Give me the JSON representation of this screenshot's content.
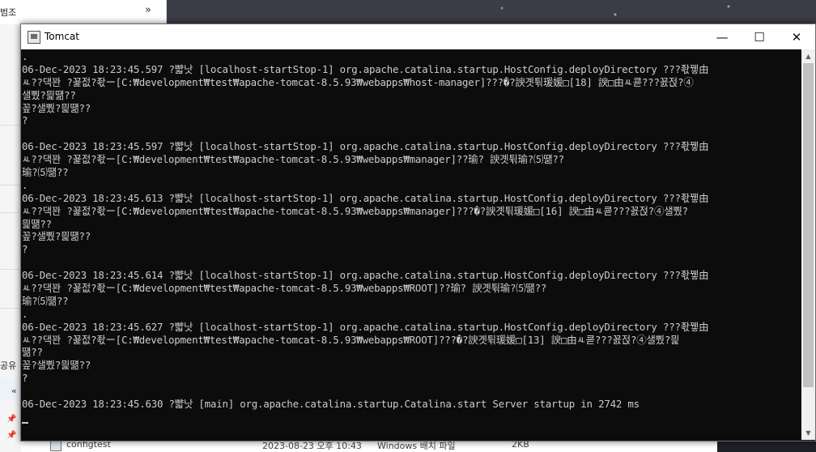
{
  "explorer": {
    "crumb": "범조",
    "chevron": "»",
    "share": "공유",
    "left_arrow": "«",
    "bottom_file": {
      "name": "configtest",
      "date": "2023-08-23 오후 10:43",
      "type": "Windows 배치 파일",
      "size": "2KB"
    }
  },
  "window": {
    "title": "Tomcat",
    "minimize": "—",
    "maximize": "☐",
    "close": "✕"
  },
  "console": {
    "lines": [
      ".",
      "06-Dec-2023 18:23:45.597 ?뺣낫 [localhost-startStop-1] org.apache.catalina.startup.HostConfig.deployDirectory ???좏뀋由",
      "ㅻ??댁꽌 ?꾩젒?좏ー[C:₩development₩test₩apache-tomcat-8.5.93₩webapps₩host-manager]???�?諛곗튂瑗媛□[18] 諛□由ㅻ쿋???꾨젅?④",
      "샐뿼?믩떎??",
      "꽆?샐뿼?믩떎??",
      "?",
      "",
      "06-Dec-2023 18:23:45.597 ?뺣낫 [localhost-startStop-1] org.apache.catalina.startup.HostConfig.deployDirectory ???좏뀋由",
      "ㅻ??댁꽌 ?꾩젒?좏ー[C:₩development₩test₩apache-tomcat-8.5.93₩webapps₩manager]??瑜? 諛곗튂瑜?⑸떎??",
      "瑜?⑸떎??",
      ".",
      "06-Dec-2023 18:23:45.613 ?뺣낫 [localhost-startStop-1] org.apache.catalina.startup.HostConfig.deployDirectory ???좏뀋由",
      "ㅻ??댁꽌 ?꾩젒?좏ー[C:₩development₩test₩apache-tomcat-8.5.93₩webapps₩manager]???�?諛곗튂瑗媛□[16] 諛□由ㅻ쿋???꾨젅?④샐뿼?",
      "믩떎??",
      "꽆?샐뿼?믩떎??",
      "?",
      "",
      "06-Dec-2023 18:23:45.614 ?뺣낫 [localhost-startStop-1] org.apache.catalina.startup.HostConfig.deployDirectory ???좏뀋由",
      "ㅻ??댁꽌 ?꾩젒?좏ー[C:₩development₩test₩apache-tomcat-8.5.93₩webapps₩ROOT]??瑜? 諛곗튂瑜?⑸떎??",
      "瑜?⑸떎??",
      ".",
      "06-Dec-2023 18:23:45.627 ?뺣낫 [localhost-startStop-1] org.apache.catalina.startup.HostConfig.deployDirectory ???좏뀋由",
      "ㅻ??댁꽌 ?꾩젒?좏ー[C:₩development₩test₩apache-tomcat-8.5.93₩webapps₩ROOT]???�?諛곗튂瑗媛□[13] 諛□由ㅻ쿋???꾨젅?④샐뿼?믩",
      "떎??",
      "꽆?샐뿼?믩떎??",
      "?",
      "",
      "06-Dec-2023 18:23:45.630 ?뺣낫 [main] org.apache.catalina.startup.Catalina.start Server startup in 2742 ms"
    ]
  }
}
